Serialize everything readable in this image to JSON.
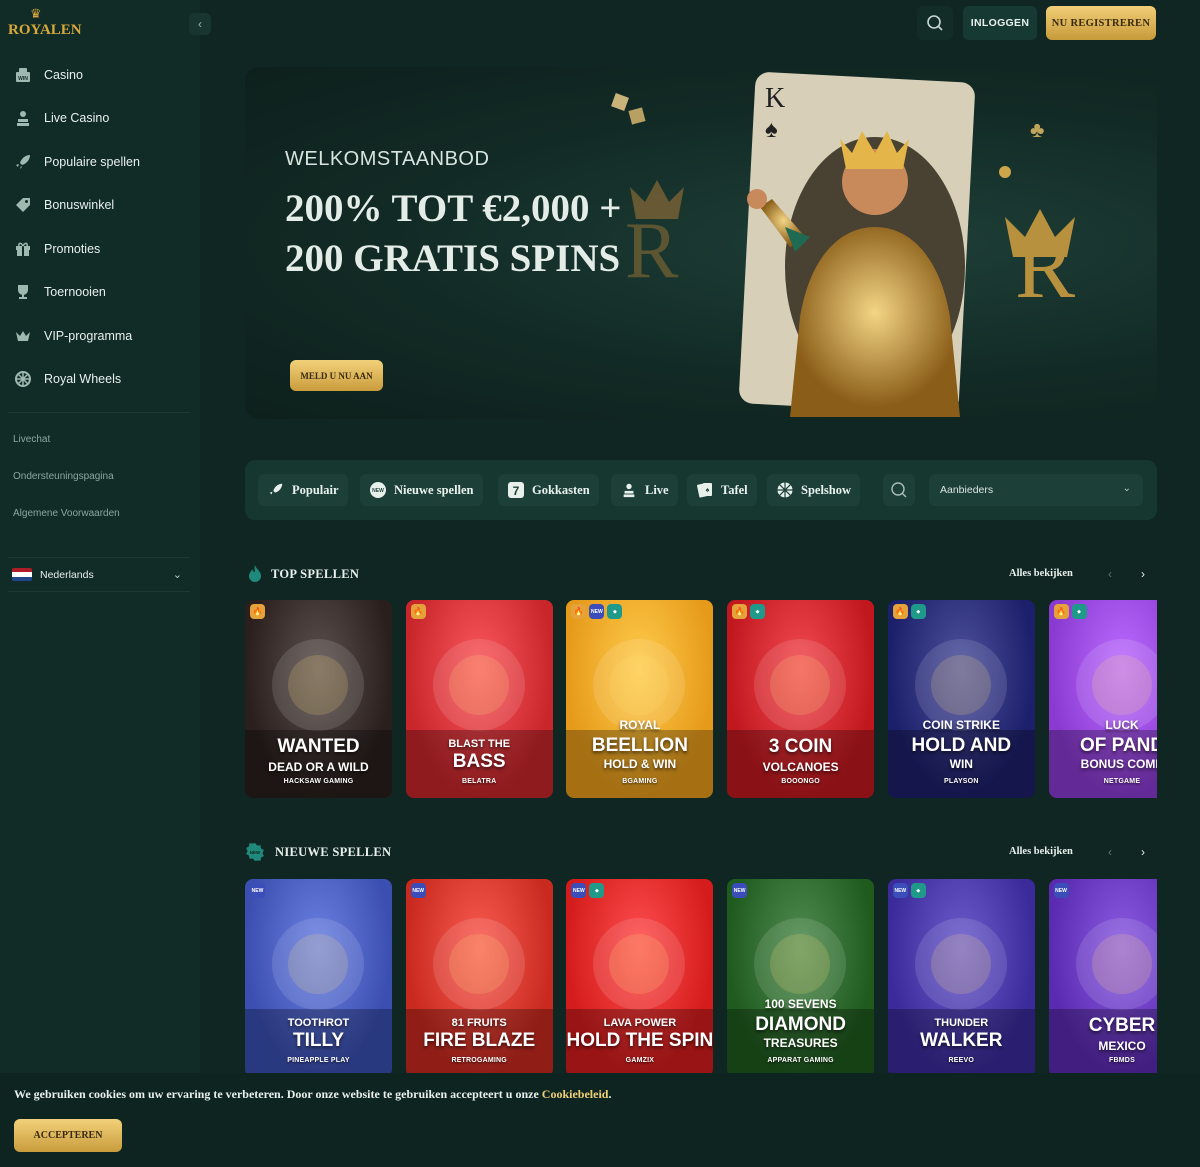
{
  "brand": {
    "logo_text": "ROYALEN"
  },
  "header": {
    "login_label": "INLOGGEN",
    "register_label": "NU REGISTREREN"
  },
  "sidebar": {
    "items": [
      {
        "label": "Casino",
        "icon": "casino-win-icon"
      },
      {
        "label": "Live Casino",
        "icon": "dealer-icon"
      },
      {
        "label": "Populaire spellen",
        "icon": "rocket-icon"
      },
      {
        "label": "Bonuswinkel",
        "icon": "tag-icon"
      },
      {
        "label": "Promoties",
        "icon": "gift-icon"
      },
      {
        "label": "Toernooien",
        "icon": "trophy-icon"
      },
      {
        "label": "VIP-programma",
        "icon": "crown-icon"
      },
      {
        "label": "Royal Wheels",
        "icon": "wheel-icon"
      }
    ],
    "links": [
      "Livechat",
      "Ondersteuningspagina",
      "Algemene Voorwaarden"
    ],
    "language": "Nederlands"
  },
  "hero": {
    "subtitle": "WELKOMSTAANBOD",
    "title": "200% TOT €2,000 + 200 GRATIS SPINS",
    "cta": "MELD U NU AAN"
  },
  "filters": {
    "chips": [
      {
        "label": "Populair",
        "icon": "rocket-icon"
      },
      {
        "label": "Nieuwe spellen",
        "icon": "new-badge-icon"
      },
      {
        "label": "Gokkasten",
        "icon": "slot-seven-icon"
      },
      {
        "label": "Live",
        "icon": "dealer-icon"
      },
      {
        "label": "Tafel",
        "icon": "cards-icon"
      },
      {
        "label": "Spelshow",
        "icon": "wheel-icon"
      }
    ],
    "providers_placeholder": "Aanbieders"
  },
  "top_games": {
    "title": "TOP SPELLEN",
    "view_all": "Alles bekijken",
    "games": [
      {
        "line1": "WANTED",
        "line2": "DEAD OR A WILD",
        "provider": "HACKSAW GAMING",
        "badges": [
          "fire"
        ],
        "bg": "#2a1f1c"
      },
      {
        "line1": "BLAST THE",
        "line2": "BASS",
        "provider": "BELATRA",
        "badges": [
          "fire"
        ],
        "bg": "#c8262b"
      },
      {
        "line1": "ROYAL",
        "line2": "BEELLION",
        "line3": "HOLD & WIN",
        "provider": "BGAMING",
        "badges": [
          "fire",
          "new",
          "gem"
        ],
        "bg": "#e69a1a"
      },
      {
        "line1": "3 COIN",
        "line2": "VOLCANOES",
        "provider": "BOOONGO",
        "badges": [
          "fire",
          "gem"
        ],
        "bg": "#c0181e"
      },
      {
        "line1": "COIN STRIKE",
        "line2": "HOLD AND",
        "line3": "WIN",
        "provider": "PLAYSON",
        "badges": [
          "fire",
          "gem"
        ],
        "bg": "#1c1f6a"
      },
      {
        "line1": "LUCK",
        "line2": "OF PAND",
        "line3": "BONUS COME",
        "provider": "NETGAME",
        "badges": [
          "fire",
          "gem"
        ],
        "bg": "#8a3ad1"
      }
    ]
  },
  "new_games": {
    "title": "NIEUWE SPELLEN",
    "view_all": "Alles bekijken",
    "games": [
      {
        "line1": "TOOTHROT",
        "line2": "TILLY",
        "provider": "PINEAPPLE PLAY",
        "badges": [
          "new"
        ],
        "bg": "#3a4fb0"
      },
      {
        "line1": "81 FRUITS",
        "line2": "FIRE BLAZE",
        "provider": "RETROGAMING",
        "badges": [
          "new"
        ],
        "bg": "#c82a20"
      },
      {
        "line1": "LAVA POWER",
        "line2": "HOLD THE SPIN",
        "provider": "GAMZIX",
        "badges": [
          "new",
          "gem"
        ],
        "bg": "#d41c1c"
      },
      {
        "line1": "100 SEVENS",
        "line2": "DIAMOND",
        "line3": "TREASURES",
        "provider": "APPARAT GAMING",
        "badges": [
          "new"
        ],
        "bg": "#1f5a1e"
      },
      {
        "line1": "THUNDER",
        "line2": "WALKER",
        "provider": "REEVO",
        "badges": [
          "new",
          "gem"
        ],
        "bg": "#3a2a9a"
      },
      {
        "line1": "CYBER",
        "line2": "MEXICO",
        "provider": "FBMDS",
        "badges": [
          "new"
        ],
        "bg": "#5a2ab0"
      }
    ]
  },
  "cookie": {
    "text": "We gebruiken cookies om uw ervaring te verbeteren. Door onze website te gebruiken accepteert u onze ",
    "link": "Cookiebeleid",
    "end": ".",
    "accept": "ACCEPTEREN"
  },
  "colors": {
    "gold": "#d8a93a",
    "bg": "#0f2622",
    "panel": "#163630"
  }
}
